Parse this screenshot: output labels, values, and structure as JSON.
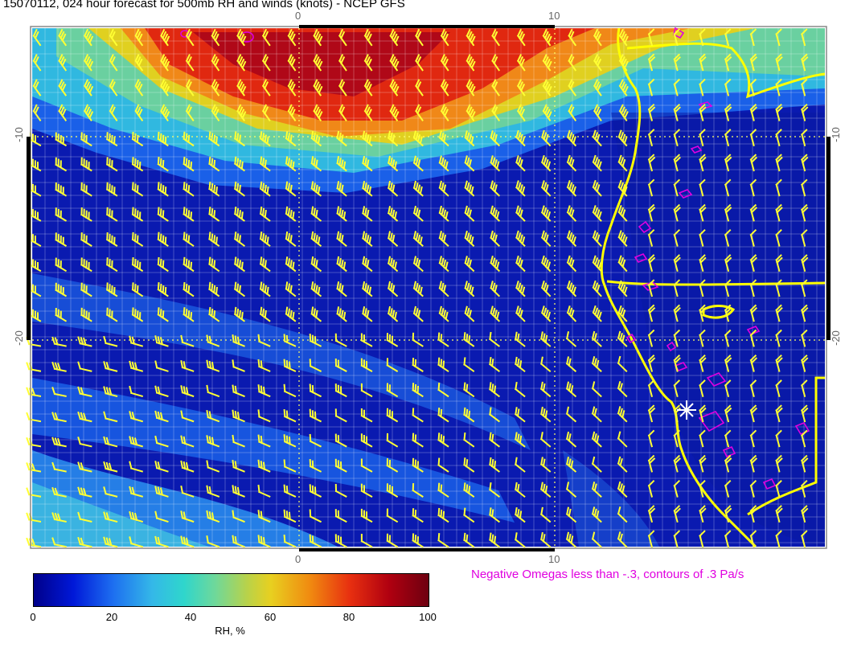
{
  "title": "15070112, 024 hour forecast for 500mb RH and winds (knots) - NCEP GFS",
  "axes": {
    "top_ticks": [
      "0",
      "10"
    ],
    "bottom_ticks": [
      "0",
      "10"
    ],
    "left_ticks": [
      "-10",
      "-20"
    ],
    "right_ticks": [
      "-10",
      "-20"
    ]
  },
  "omega_note": "Negative Omegas less than -.3, contours of .3 Pa/s",
  "colorbar": {
    "label": "RH, %",
    "ticks": [
      "0",
      "20",
      "40",
      "60",
      "80",
      "100"
    ],
    "range": [
      0,
      100
    ]
  },
  "colors": {
    "wind_barbs": "#ffff33",
    "coastline": "#ffff00",
    "omega_contours": "#e000e0",
    "grid": "#ffffff"
  },
  "icons": {
    "location_marker": "white-asterisk-icon"
  }
}
